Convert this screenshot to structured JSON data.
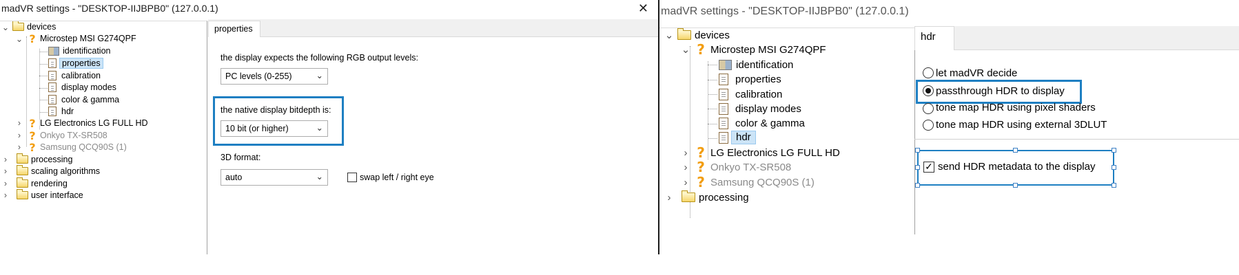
{
  "left_window": {
    "title": "madVR settings - \"DESKTOP-IIJBPB0\" (127.0.0.1)",
    "close_glyph": "✕",
    "tree": {
      "devices": "devices",
      "device1": "Microstep MSI G274QPF",
      "identification": "identification",
      "properties": "properties",
      "calibration": "calibration",
      "display_modes": "display modes",
      "color_gamma": "color & gamma",
      "hdr": "hdr",
      "device2": "LG Electronics LG FULL HD",
      "device3": "Onkyo TX-SR508",
      "device4": "Samsung QCQ90S (1)",
      "processing": "processing",
      "scaling": "scaling algorithms",
      "rendering": "rendering",
      "user_interface": "user interface"
    },
    "tab": "properties",
    "rgb_label": "the display expects the following RGB output levels:",
    "rgb_value": "PC levels (0-255)",
    "bitdepth_label": "the native display bitdepth is:",
    "bitdepth_value": "10 bit (or higher)",
    "format3d_label": "3D format:",
    "format3d_value": "auto",
    "swap_label": "swap left / right eye",
    "swap_checked": false
  },
  "right_window": {
    "title": "madVR settings - \"DESKTOP-IIJBPB0\" (127.0.0.1)",
    "tree": {
      "devices": "devices",
      "device1": "Microstep MSI G274QPF",
      "identification": "identification",
      "properties": "properties",
      "calibration": "calibration",
      "display_modes": "display modes",
      "color_gamma": "color & gamma",
      "hdr": "hdr",
      "device2": "LG Electronics LG FULL HD",
      "device3": "Onkyo TX-SR508",
      "device4": "Samsung QCQ90S (1)",
      "processing": "processing"
    },
    "tab": "hdr",
    "options": [
      {
        "label": "let madVR decide",
        "selected": false
      },
      {
        "label": "passthrough HDR to display",
        "selected": true
      },
      {
        "label": "tone map HDR using pixel shaders",
        "selected": false
      },
      {
        "label": "tone map HDR using external 3DLUT",
        "selected": false
      }
    ],
    "metadata_label": "send HDR metadata to the display",
    "metadata_checked": true
  },
  "colors": {
    "highlight": "#1e7fc2",
    "selection": "#cce4f7",
    "question": "#f29d0e"
  }
}
